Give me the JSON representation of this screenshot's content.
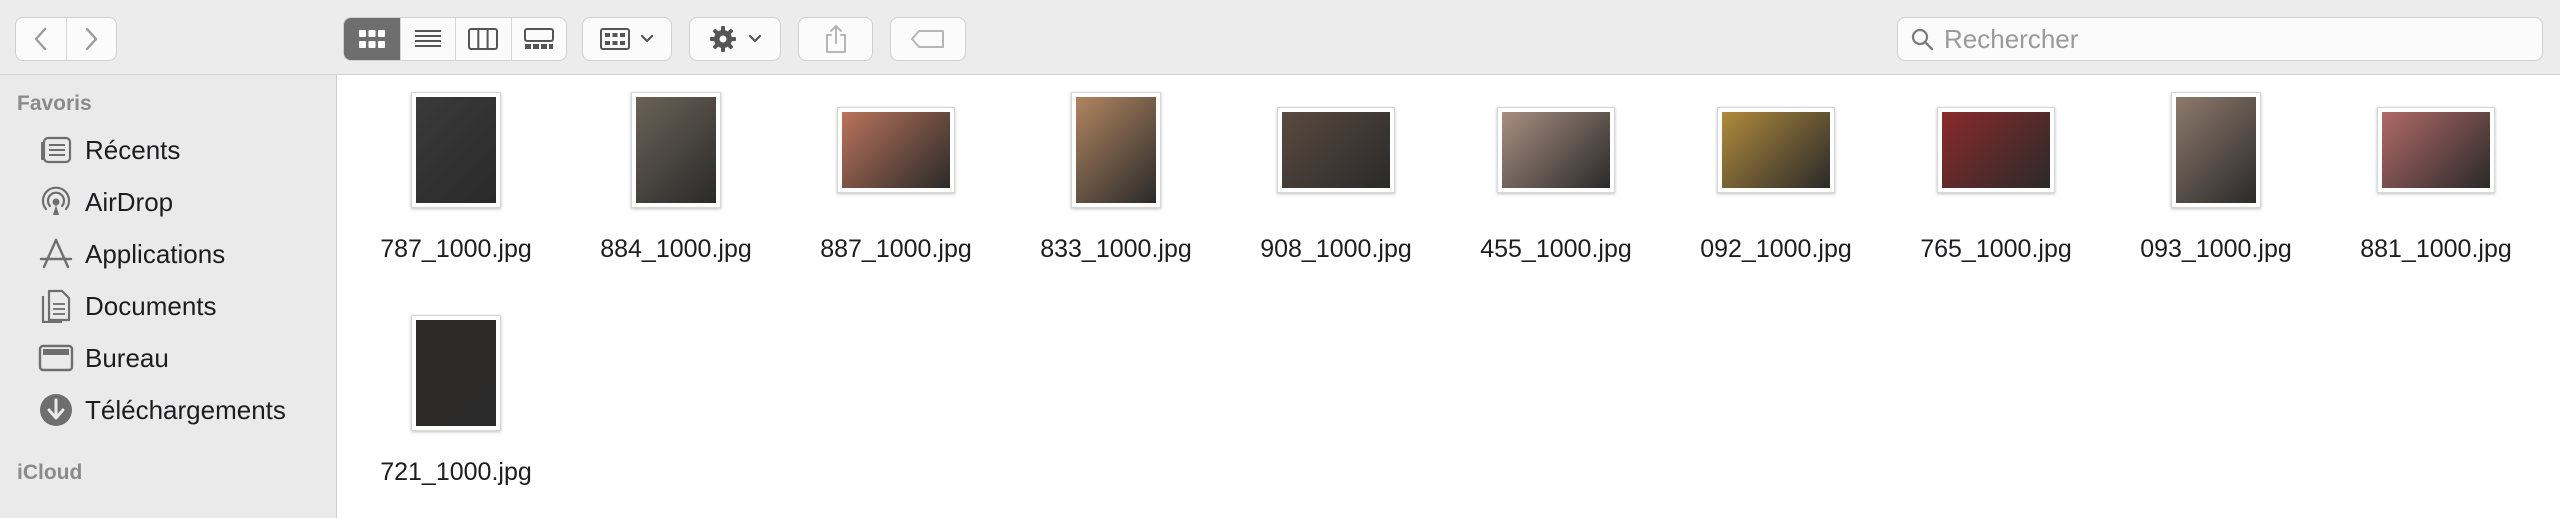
{
  "toolbar": {
    "back_icon": "chevron-left-icon",
    "forward_icon": "chevron-right-icon",
    "view_modes": [
      "icon-view",
      "list-view",
      "column-view",
      "gallery-view"
    ],
    "active_view": "icon-view",
    "group_icon": "group-grid-icon",
    "action_icon": "gear-icon",
    "share_icon": "share-icon",
    "tag_icon": "tag-icon"
  },
  "search": {
    "placeholder": "Rechercher"
  },
  "sidebar": {
    "favorites_header": "Favoris",
    "items": [
      {
        "label": "Récents",
        "icon": "clock-icon"
      },
      {
        "label": "AirDrop",
        "icon": "airdrop-icon"
      },
      {
        "label": "Applications",
        "icon": "applications-icon"
      },
      {
        "label": "Documents",
        "icon": "document-icon"
      },
      {
        "label": "Bureau",
        "icon": "desktop-icon"
      },
      {
        "label": "Téléchargements",
        "icon": "download-icon"
      }
    ],
    "icloud_header": "iCloud"
  },
  "files": [
    {
      "name": "787_1000.jpg",
      "orientation": "portrait",
      "tone": "#3a3a3a"
    },
    {
      "name": "884_1000.jpg",
      "orientation": "portrait",
      "tone": "#6b6257"
    },
    {
      "name": "887_1000.jpg",
      "orientation": "landscape",
      "tone": "#b9735a"
    },
    {
      "name": "833_1000.jpg",
      "orientation": "portrait",
      "tone": "#b08560"
    },
    {
      "name": "908_1000.jpg",
      "orientation": "landscape",
      "tone": "#5a4a40"
    },
    {
      "name": "455_1000.jpg",
      "orientation": "landscape",
      "tone": "#a88e80"
    },
    {
      "name": "092_1000.jpg",
      "orientation": "landscape",
      "tone": "#b08a3c"
    },
    {
      "name": "765_1000.jpg",
      "orientation": "landscape",
      "tone": "#8a2a2a"
    },
    {
      "name": "093_1000.jpg",
      "orientation": "portrait",
      "tone": "#8e7a6c"
    },
    {
      "name": "881_1000.jpg",
      "orientation": "landscape",
      "tone": "#b06a66"
    },
    {
      "name": "721_1000.jpg",
      "orientation": "portrait",
      "tone": "#2e2a28"
    }
  ]
}
